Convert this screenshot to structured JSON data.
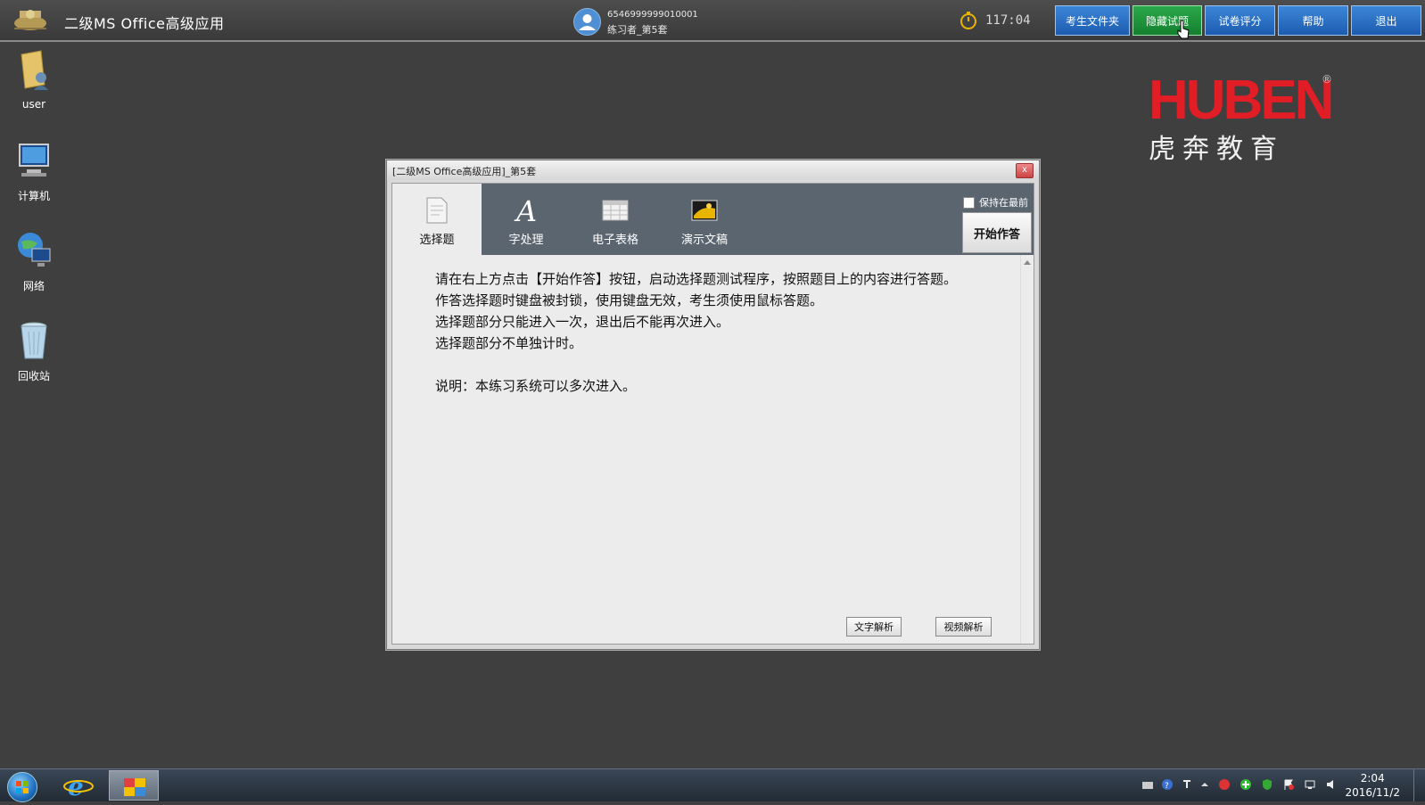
{
  "topbar": {
    "app_title": "二级MS Office高级应用",
    "user_id": "6546999999010001",
    "user_name": "练习者_第5套",
    "timer": "117:04",
    "buttons": [
      {
        "label": "考生文件夹"
      },
      {
        "label": "隐藏试题"
      },
      {
        "label": "试卷评分"
      },
      {
        "label": "帮助"
      },
      {
        "label": "退出"
      }
    ]
  },
  "desktop": {
    "icons": [
      {
        "label": "user",
        "icon": "user-folder-icon"
      },
      {
        "label": "计算机",
        "icon": "computer-icon"
      },
      {
        "label": "网络",
        "icon": "network-icon"
      },
      {
        "label": "回收站",
        "icon": "recycle-bin-icon"
      }
    ]
  },
  "brand": {
    "latin": "HUBEN",
    "chinese": "虎奔教育",
    "reg": "®"
  },
  "dialog": {
    "title": "[二级MS Office高级应用]_第5套",
    "close_label": "x",
    "tabs": [
      {
        "label": "选择题",
        "icon": "document-icon",
        "active": true
      },
      {
        "label": "字处理",
        "icon": "font-a-icon",
        "active": false
      },
      {
        "label": "电子表格",
        "icon": "spreadsheet-icon",
        "active": false
      },
      {
        "label": "演示文稿",
        "icon": "presentation-icon",
        "active": false
      }
    ],
    "keep_on_top_label": "保持在最前",
    "start_button": "开始作答",
    "content": {
      "line1": "请在右上方点击【开始作答】按钮，启动选择题测试程序，按照题目上的内容进行答题。",
      "line2": "作答选择题时键盘被封锁，使用键盘无效，考生须使用鼠标答题。",
      "line3": "选择题部分只能进入一次，退出后不能再次进入。",
      "line4": "选择题部分不单独计时。",
      "line5": "说明：本练习系统可以多次进入。"
    },
    "text_analysis_button": "文字解析",
    "video_analysis_button": "视频解析"
  },
  "taskbar": {
    "time": "2:04",
    "date": "2016/11/2"
  },
  "colors": {
    "accent_blue": "#1d5cb0",
    "accent_green": "#15802f",
    "brand_red": "#e11d26"
  }
}
